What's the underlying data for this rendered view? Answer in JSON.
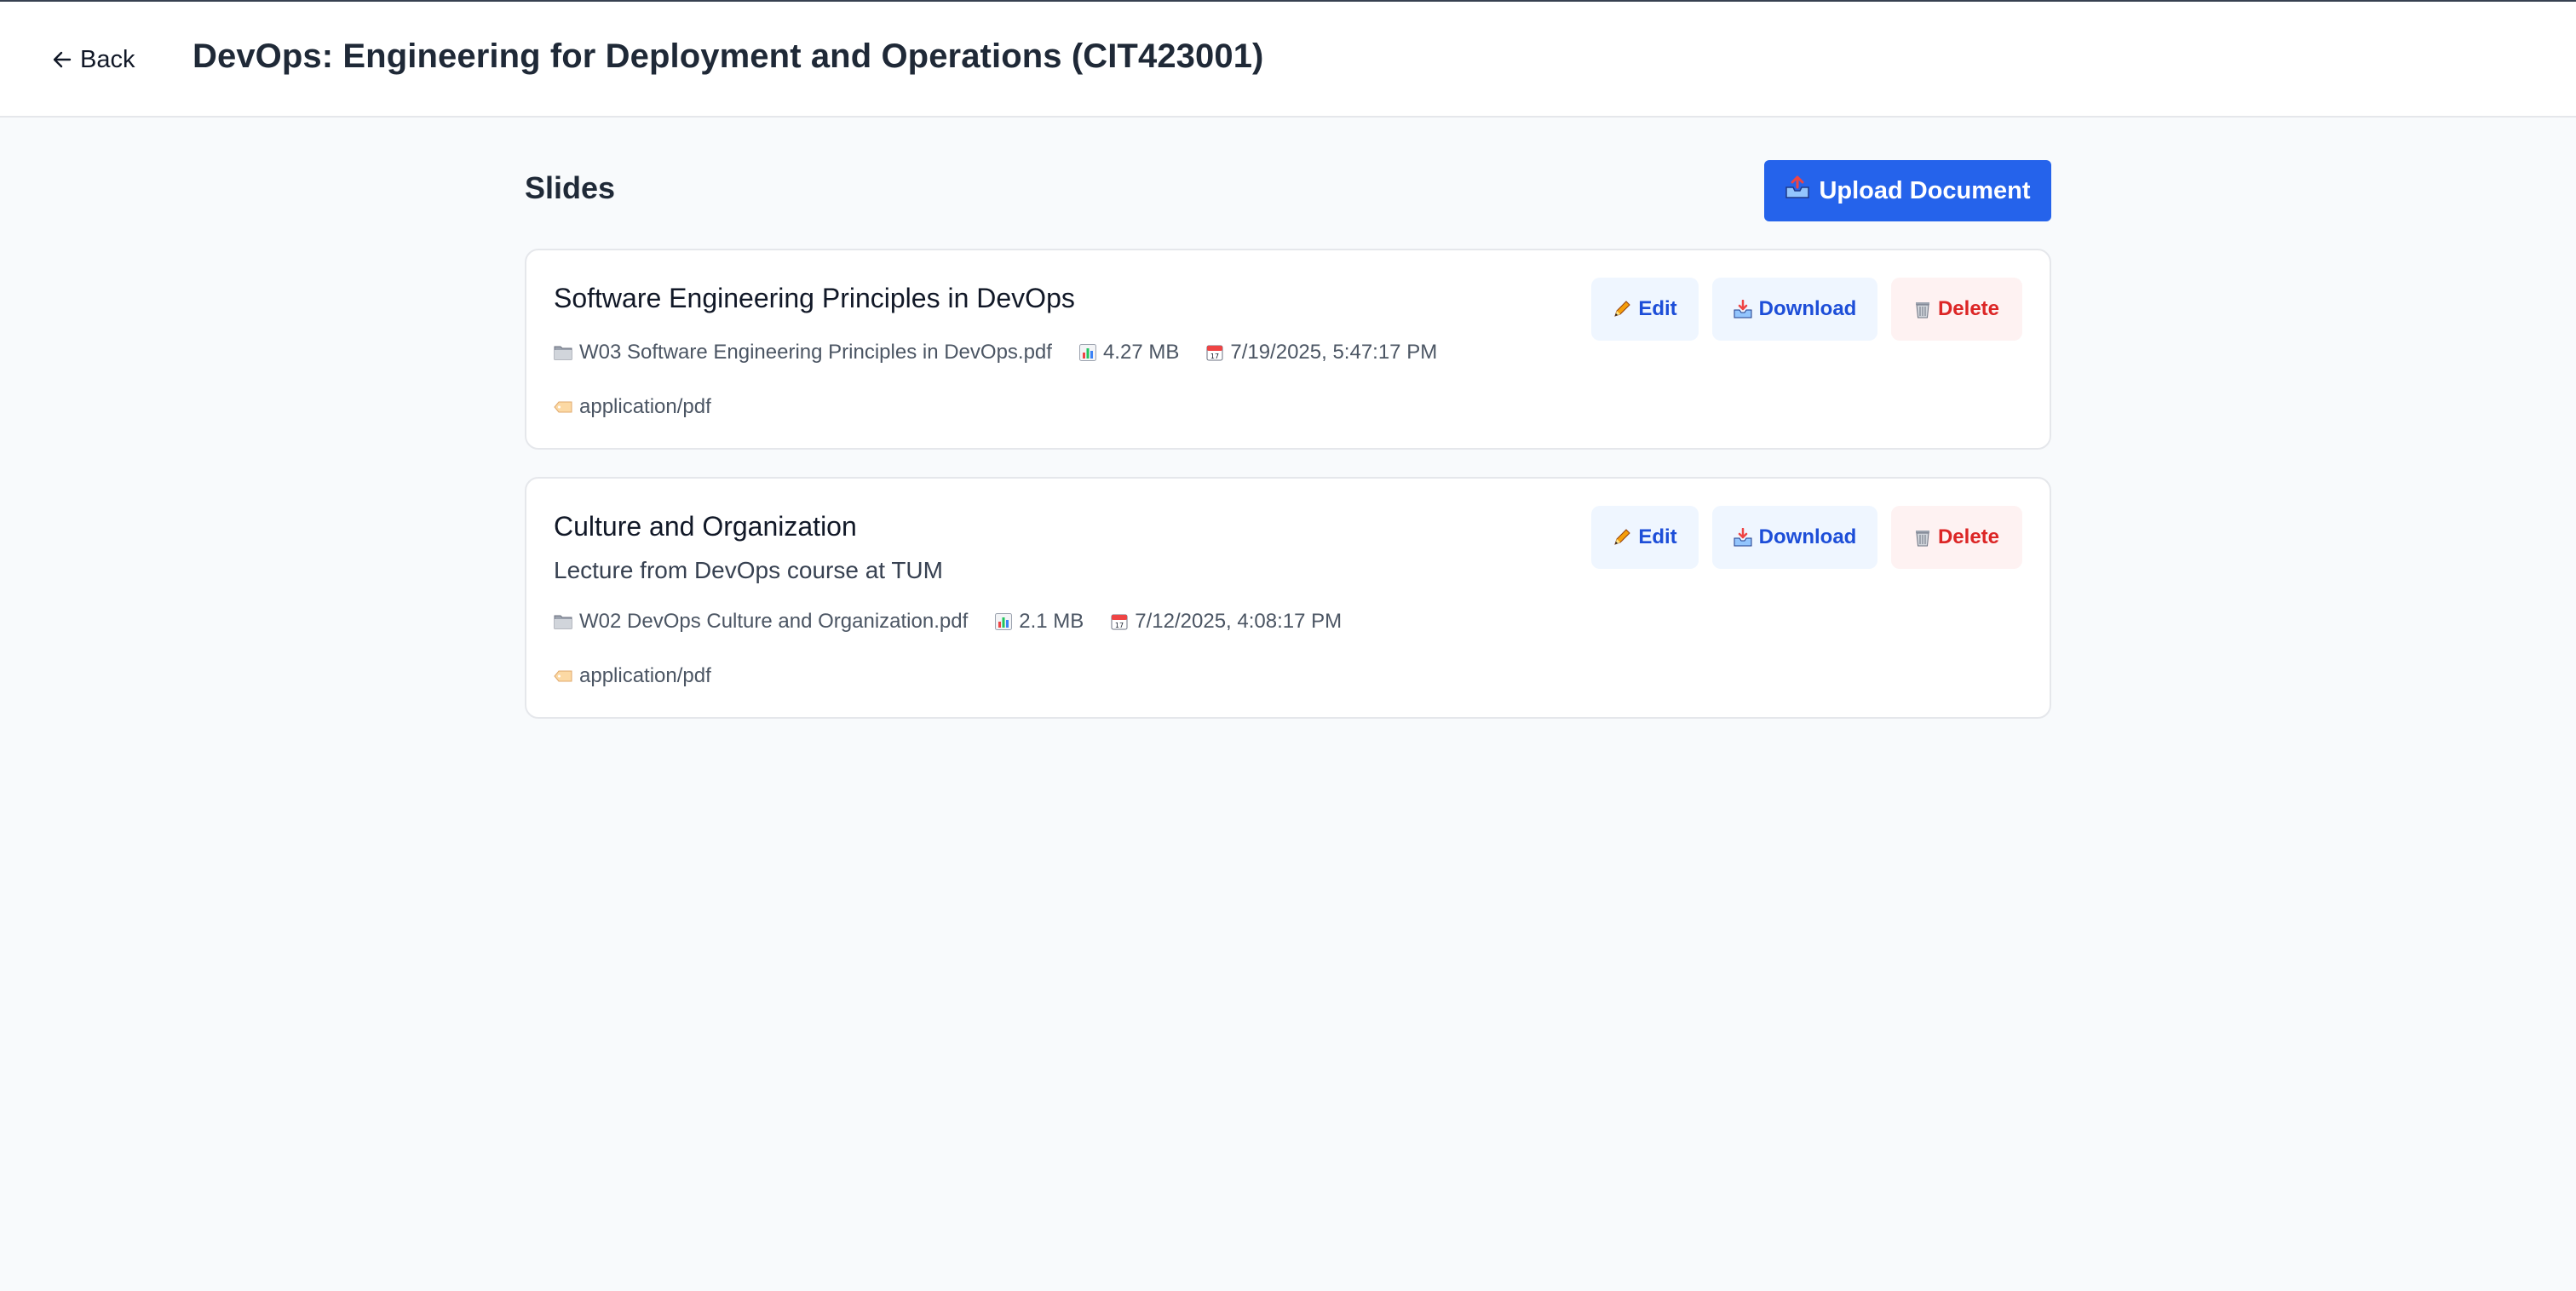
{
  "header": {
    "back_label": "Back",
    "title": "DevOps: Engineering for Deployment and Operations (CIT423001)"
  },
  "section": {
    "title": "Slides",
    "upload_label": "Upload Document"
  },
  "actions": {
    "edit_label": "Edit",
    "download_label": "Download",
    "delete_label": "Delete"
  },
  "documents": [
    {
      "title": "Software Engineering Principles in DevOps",
      "description": "",
      "filename": "W03 Software Engineering Principles in DevOps.pdf",
      "size": "4.27 MB",
      "date": "7/19/2025, 5:47:17 PM",
      "mime": "application/pdf"
    },
    {
      "title": "Culture and Organization",
      "description": "Lecture from DevOps course at TUM",
      "filename": "W02 DevOps Culture and Organization.pdf",
      "size": "2.1 MB",
      "date": "7/12/2025, 4:08:17 PM",
      "mime": "application/pdf"
    }
  ],
  "icons": {
    "back": "arrow-left-icon",
    "upload": "outbox-tray-icon",
    "file": "file-folder-icon",
    "size": "bar-chart-icon",
    "date": "calendar-icon",
    "type": "label-tag-icon",
    "edit": "pencil-icon",
    "download": "inbox-tray-icon",
    "delete": "wastebasket-icon"
  },
  "colors": {
    "primary": "#2563eb",
    "secondary_bg": "#eff6ff",
    "secondary_text": "#1d4ed8",
    "danger_bg": "#fef2f2",
    "danger_text": "#dc2626",
    "page_bg": "#f8fafc"
  }
}
